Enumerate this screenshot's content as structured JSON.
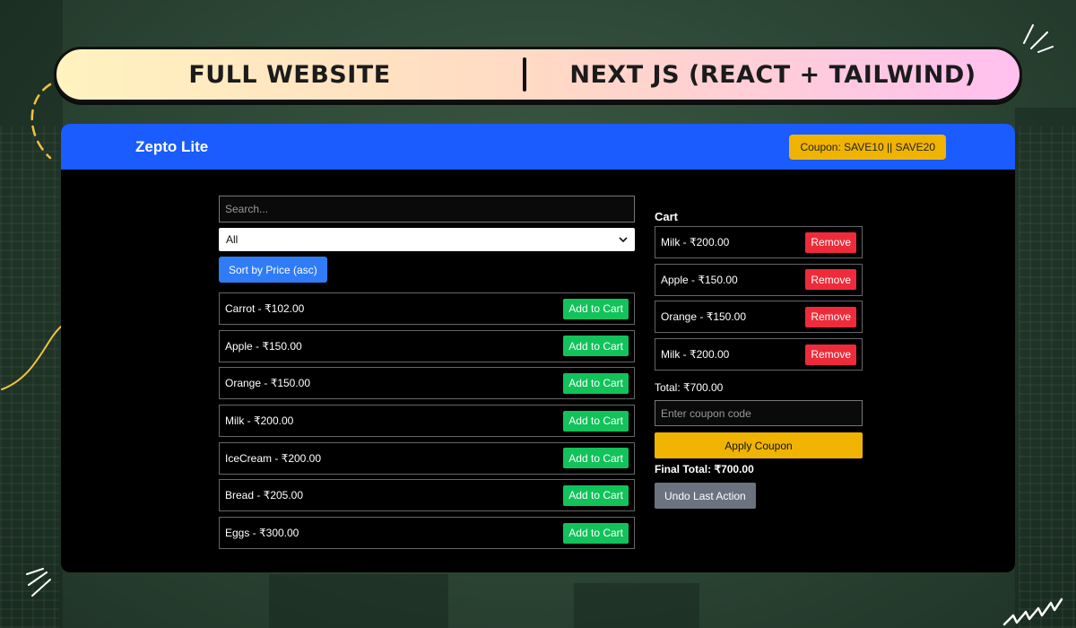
{
  "banner": {
    "left_text": "FULL WEBSITE",
    "right_text": "NEXT JS (REACT + TAILWIND)"
  },
  "app": {
    "brand": "Zepto Lite",
    "coupon_badge": "Coupon: SAVE10 || SAVE20",
    "search": {
      "placeholder": "Search...",
      "value": ""
    },
    "category_filter": {
      "selected": "All"
    },
    "sort_button": "Sort by Price (asc)",
    "products": [
      {
        "label": "Carrot - ₹102.00",
        "action": "Add to Cart"
      },
      {
        "label": "Apple - ₹150.00",
        "action": "Add to Cart"
      },
      {
        "label": "Orange - ₹150.00",
        "action": "Add to Cart"
      },
      {
        "label": "Milk - ₹200.00",
        "action": "Add to Cart"
      },
      {
        "label": "IceCream - ₹200.00",
        "action": "Add to Cart"
      },
      {
        "label": "Bread - ₹205.00",
        "action": "Add to Cart"
      },
      {
        "label": "Eggs - ₹300.00",
        "action": "Add to Cart"
      }
    ],
    "cart": {
      "title": "Cart",
      "items": [
        {
          "label": "Milk - ₹200.00",
          "action": "Remove"
        },
        {
          "label": "Apple - ₹150.00",
          "action": "Remove"
        },
        {
          "label": "Orange - ₹150.00",
          "action": "Remove"
        },
        {
          "label": "Milk - ₹200.00",
          "action": "Remove"
        }
      ],
      "total": "Total: ₹700.00",
      "coupon_input": {
        "placeholder": "Enter coupon code",
        "value": ""
      },
      "apply_button": "Apply Coupon",
      "final_total": "Final Total: ₹700.00",
      "undo_button": "Undo Last Action"
    }
  },
  "colors": {
    "navbar": "#1a5cff",
    "coupon_badge": "#f0b400",
    "add_button": "#12c25a",
    "remove_button": "#ee2b3a",
    "sort_button": "#2f7cf6",
    "undo_button": "#6b7280"
  }
}
